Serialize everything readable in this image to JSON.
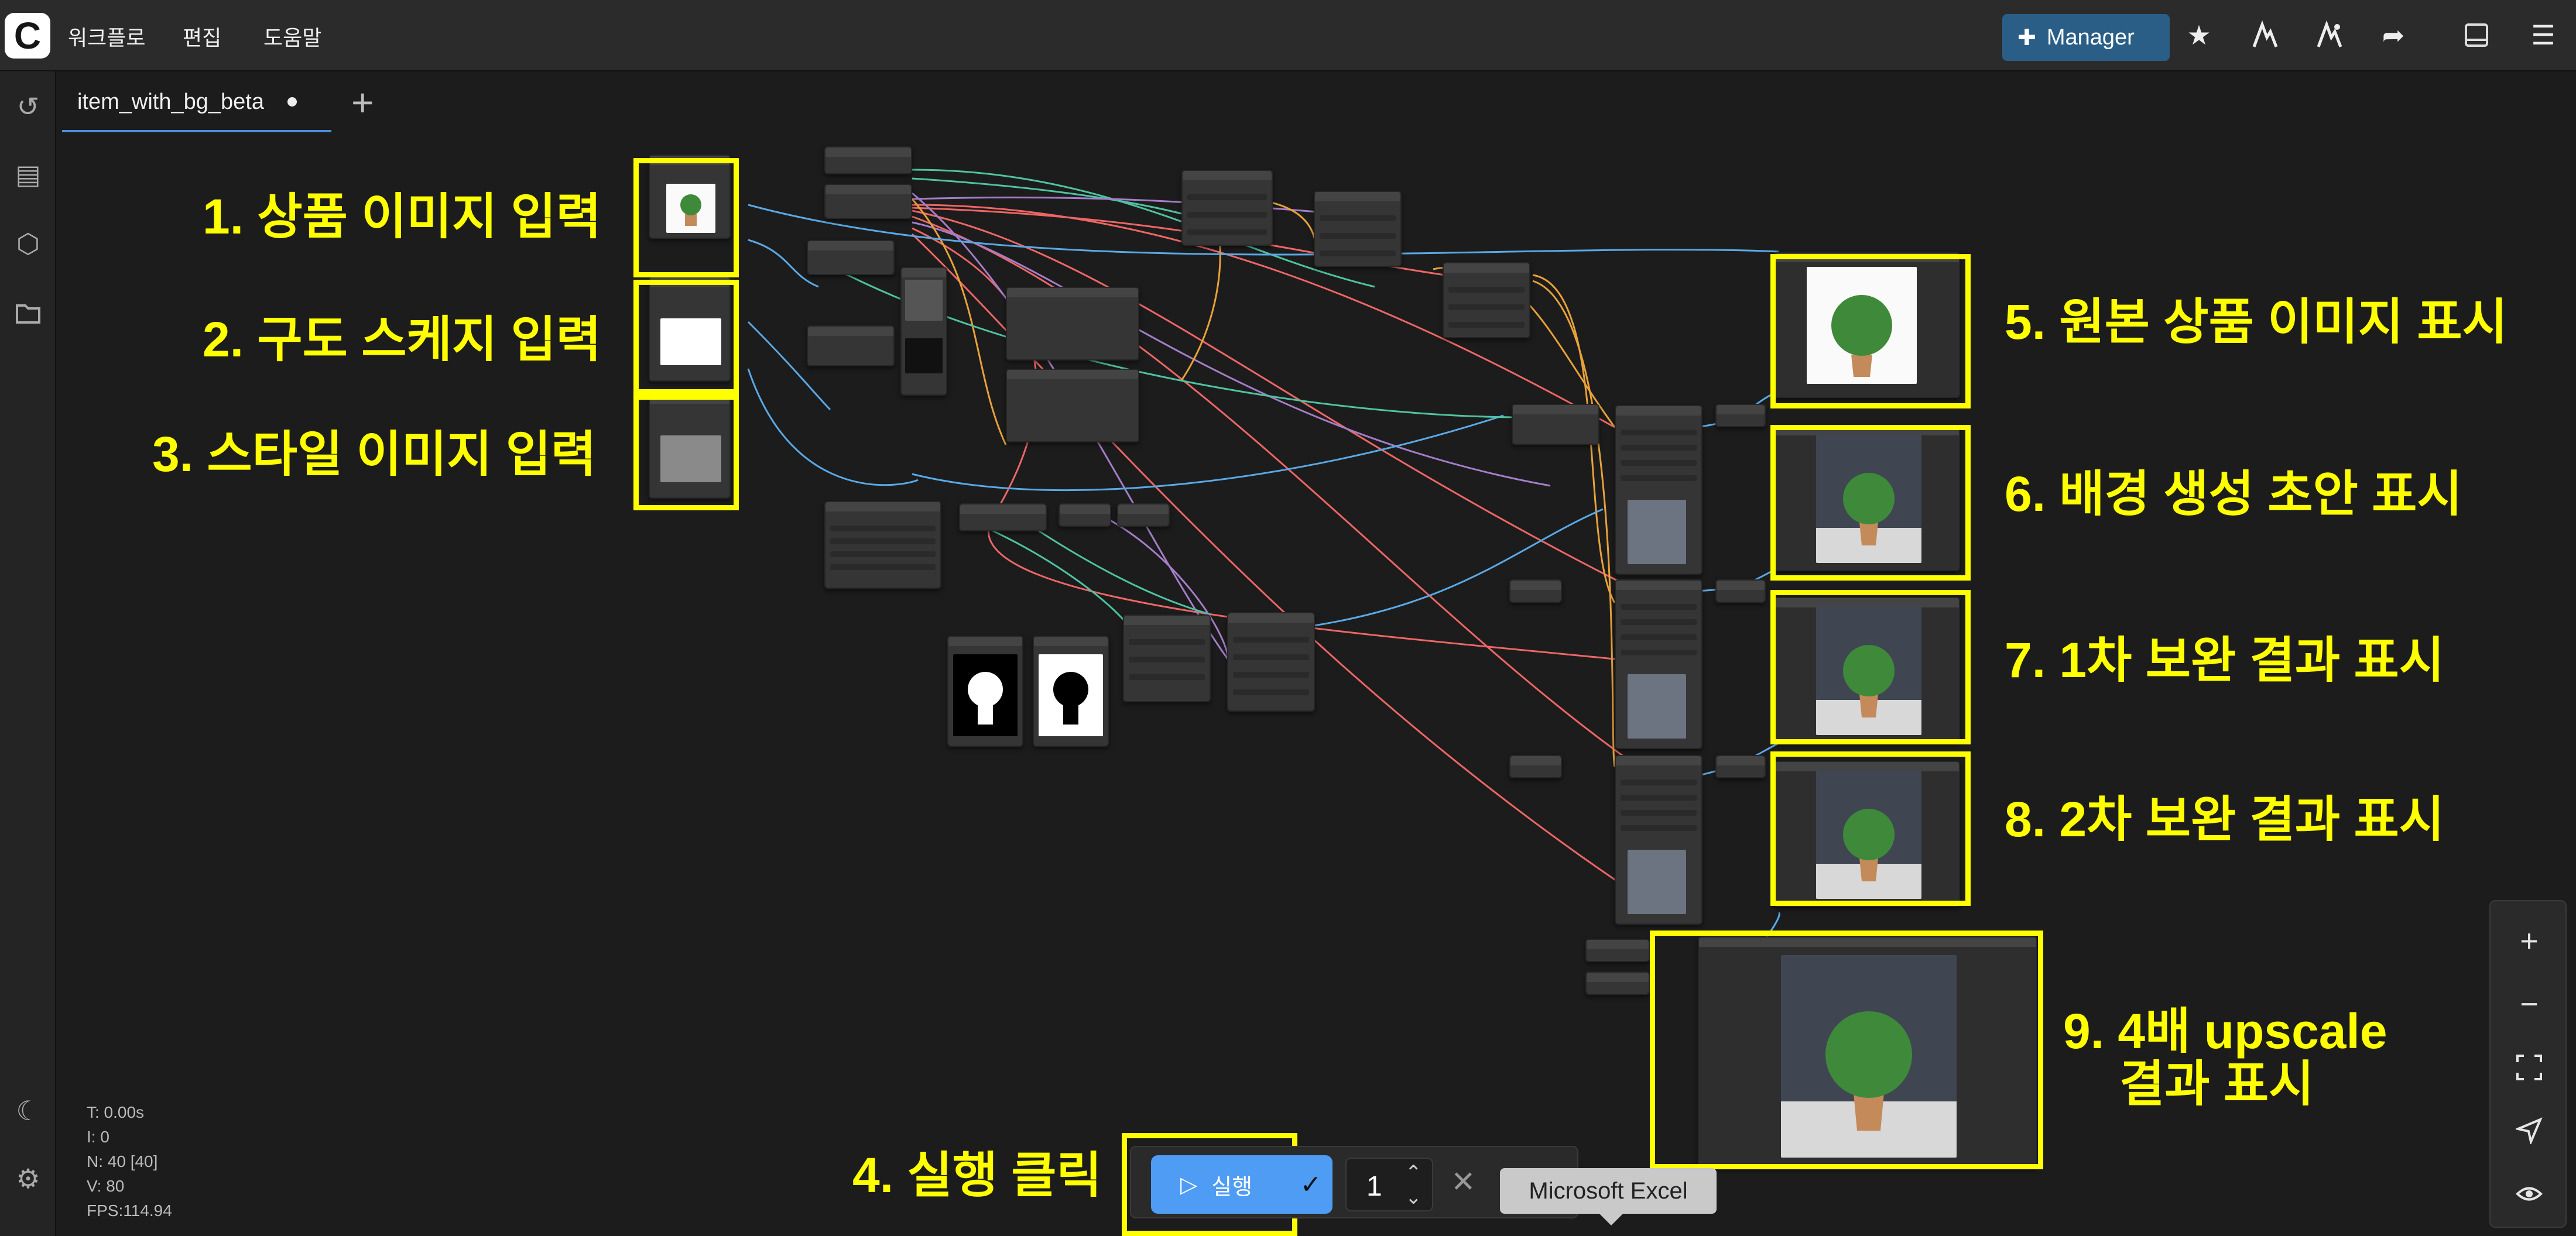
{
  "menu": {
    "workflow": "워크플로",
    "edit": "편집",
    "help": "도움말"
  },
  "manager": {
    "label": "Manager"
  },
  "tab": {
    "name": "item_with_bg_beta"
  },
  "annotations": {
    "a1": "1. 상품 이미지 입력",
    "a2": "2. 구도 스케지 입력",
    "a3": "3. 스타일 이미지 입력",
    "a4": "4. 실행 클릭",
    "a5": "5. 원본 상품 이미지 표시",
    "a6": "6. 배경 생성 초안 표시",
    "a7": "7. 1차 보완 결과 표시",
    "a8": "8. 2차 보완 결과 표시",
    "a9_line1": "9. 4배 upscale",
    "a9_line2": "결과 표시"
  },
  "stats": {
    "t": "T: 0.00s",
    "i": "I: 0",
    "n": "N: 40 [40]",
    "v": "V: 80",
    "fps": "FPS:114.94"
  },
  "run": {
    "label": "실행",
    "batch_count": "1"
  },
  "tooltip": {
    "text": "Microsoft Excel"
  },
  "colors": {
    "accent": "#4e9cf3",
    "annotation": "#ffff00",
    "manager": "#2a5e87"
  }
}
